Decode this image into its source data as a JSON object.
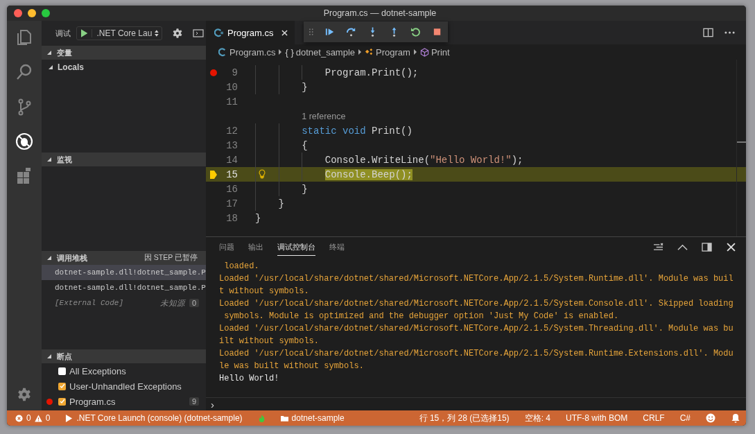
{
  "window": {
    "title": "Program.cs — dotnet-sample"
  },
  "activity_bar": [
    {
      "selected": false
    },
    {
      "selected": false
    },
    {
      "selected": false
    },
    {
      "selected": true
    },
    {
      "selected": false
    }
  ],
  "sidebar": {
    "toolbar": {
      "label": "调试",
      "configuration": ".NET Core Lau"
    },
    "sections": [
      {
        "kind": "variables",
        "title": "变量",
        "expanded": true,
        "groups": [
          {
            "label": "Locals",
            "expanded": true
          }
        ]
      },
      {
        "kind": "watch",
        "title": "监视",
        "expanded": true
      },
      {
        "kind": "callstack",
        "title": "调用堆栈",
        "expanded": true,
        "status": "因 STEP 已暂停",
        "frames": [
          {
            "kind": "frame",
            "text": "dotnet-sample.dll!dotnet_sample.P",
            "selected": true
          },
          {
            "kind": "frame",
            "text": "dotnet-sample.dll!dotnet_sample.P",
            "selected": false
          },
          {
            "kind": "external",
            "text": "[External Code]",
            "source": "未知源",
            "line": "0",
            "selected": false
          }
        ]
      },
      {
        "kind": "breakpoints",
        "title": "断点",
        "expanded": true,
        "items": [
          {
            "kind": "exception",
            "label": "All Exceptions",
            "checked": false
          },
          {
            "kind": "exception",
            "label": "User-Unhandled Exceptions",
            "checked": true
          },
          {
            "kind": "file",
            "label": "Program.cs",
            "checked": true,
            "line": "9"
          }
        ]
      }
    ]
  },
  "editor": {
    "tabs": [
      {
        "label": "Program.cs",
        "selected": true
      }
    ],
    "breadcrumbs": [
      {
        "kind": "file",
        "label": "Program.cs"
      },
      {
        "kind": "namespace",
        "glyph": "{ }",
        "label": "dotnet_sample"
      },
      {
        "kind": "class",
        "label": "Program"
      },
      {
        "kind": "method",
        "label": "Print"
      }
    ],
    "lines": [
      {
        "number": "9",
        "breakpoint": true,
        "current": false,
        "tokens": [
          {
            "kind": "plain",
            "text": "            Program.Print();"
          }
        ]
      },
      {
        "number": "10",
        "breakpoint": false,
        "current": false,
        "tokens": [
          {
            "kind": "plain",
            "text": "        }"
          }
        ]
      },
      {
        "number": "11",
        "breakpoint": false,
        "current": false
      },
      {
        "number": "12",
        "breakpoint": false,
        "current": false,
        "lens": "1 reference",
        "tokens": [
          {
            "kind": "keyword",
            "text": "        static"
          },
          {
            "kind": "keyword",
            "text": " void"
          },
          {
            "kind": "plain",
            "text": " Print()"
          }
        ]
      },
      {
        "number": "13",
        "breakpoint": false,
        "current": false,
        "tokens": [
          {
            "kind": "plain",
            "text": "        {"
          }
        ]
      },
      {
        "number": "14",
        "breakpoint": false,
        "current": false,
        "tokens": [
          {
            "kind": "plain",
            "text": "            Console.WriteLine("
          },
          {
            "kind": "string",
            "text": "\"Hello World!\""
          },
          {
            "kind": "plain",
            "text": ");"
          }
        ]
      },
      {
        "number": "15",
        "breakpoint": false,
        "current": true,
        "tokens": [
          {
            "kind": "selection",
            "text": "            Console.Beep();"
          }
        ]
      },
      {
        "number": "16",
        "breakpoint": false,
        "current": false,
        "tokens": [
          {
            "kind": "plain",
            "text": "        }"
          }
        ]
      },
      {
        "number": "17",
        "breakpoint": false,
        "current": false,
        "tokens": [
          {
            "kind": "plain",
            "text": "    }"
          }
        ]
      },
      {
        "number": "18",
        "breakpoint": false,
        "current": false,
        "tokens": [
          {
            "kind": "plain",
            "text": "}"
          }
        ]
      }
    ]
  },
  "panel": {
    "tabs": [
      {
        "label": "问题",
        "selected": false
      },
      {
        "label": "输出",
        "selected": false
      },
      {
        "label": "调试控制台",
        "selected": true
      },
      {
        "label": "终端",
        "selected": false
      }
    ],
    "output": [
      {
        "kind": "log",
        "text": " loaded."
      },
      {
        "kind": "log",
        "text": "Loaded '/usr/local/share/dotnet/shared/Microsoft.NETCore.App/2.1.5/System.Runtime.dll'. Module was buil"
      },
      {
        "kind": "log",
        "text": "t without symbols."
      },
      {
        "kind": "log",
        "text": "Loaded '/usr/local/share/dotnet/shared/Microsoft.NETCore.App/2.1.5/System.Console.dll'. Skipped loading"
      },
      {
        "kind": "log",
        "text": " symbols. Module is optimized and the debugger option 'Just My Code' is enabled."
      },
      {
        "kind": "log",
        "text": "Loaded '/usr/local/share/dotnet/shared/Microsoft.NETCore.App/2.1.5/System.Threading.dll'. Module was bu"
      },
      {
        "kind": "log",
        "text": "ilt without symbols."
      },
      {
        "kind": "log",
        "text": "Loaded '/usr/local/share/dotnet/shared/Microsoft.NETCore.App/2.1.5/System.Runtime.Extensions.dll'. Modu"
      },
      {
        "kind": "log",
        "text": "le was built without symbols."
      },
      {
        "kind": "program",
        "text": "Hello World!"
      }
    ],
    "prompt": "›"
  },
  "status_bar": {
    "errors": "0",
    "warnings": "0",
    "launch": ".NET Core Launch (console) (dotnet-sample)",
    "folder": "dotnet-sample",
    "position": "行 15，列 28 (已选择15)",
    "indentation": "空格: 4",
    "encoding": "UTF-8 with BOM",
    "line_ending": "CRLF",
    "language": "C#"
  }
}
